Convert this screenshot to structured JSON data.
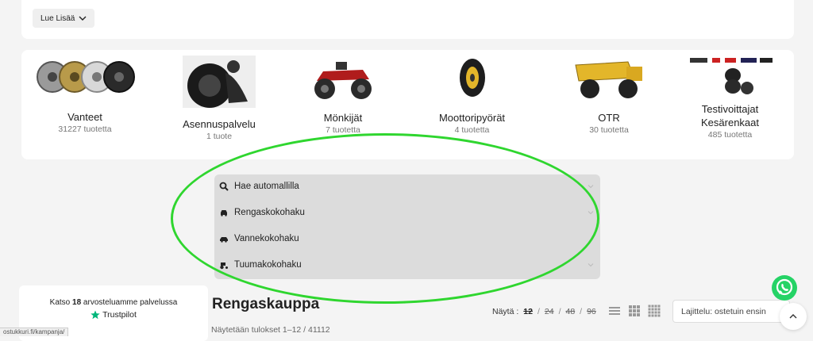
{
  "top": {
    "read_more_label": "Lue Lisää"
  },
  "categories": [
    {
      "name": "Vanteet",
      "count": "31227 tuotetta",
      "icon": "rims-image"
    },
    {
      "name": "Asennuspalvelu",
      "count": "1 tuote",
      "icon": "mechanic-image"
    },
    {
      "name": "Mönkijät",
      "count": "7 tuotetta",
      "icon": "atv-image"
    },
    {
      "name": "Moottoripyörät",
      "count": "4 tuotetta",
      "icon": "motorcycle-tire-image"
    },
    {
      "name": "OTR",
      "count": "30 tuotetta",
      "icon": "dump-truck-image"
    },
    {
      "name": "Testivoittajat Kesärenkaat",
      "count": "485 tuotetta",
      "icon": "tire-stack-image"
    }
  ],
  "search_accordion": [
    {
      "label": "Hae automallilla",
      "icon": "search-icon"
    },
    {
      "label": "Rengaskokohaku",
      "icon": "car-icon"
    },
    {
      "label": "Vannekokohaku",
      "icon": "car-icon"
    },
    {
      "label": "Tuumakokohaku",
      "icon": "tractor-icon"
    }
  ],
  "trustpilot": {
    "text_before": "Katso ",
    "count": "18",
    "text_after": " arvosteluamme palvelussa",
    "brand": "Trustpilot"
  },
  "shop": {
    "title": "Rengaskauppa",
    "results": "Näytetään tulokset 1–12 / 41112",
    "show_label": "Näytä :",
    "per_page": [
      "12",
      "24",
      "48",
      "96"
    ],
    "sort_label": "Lajittelu: ostetuin ensin"
  },
  "status_url": "ostukkuri.fi/kampanja/",
  "colors": {
    "highlight": "#2fd62f",
    "whatsapp": "#25d366",
    "trustpilot": "#00b67a"
  }
}
